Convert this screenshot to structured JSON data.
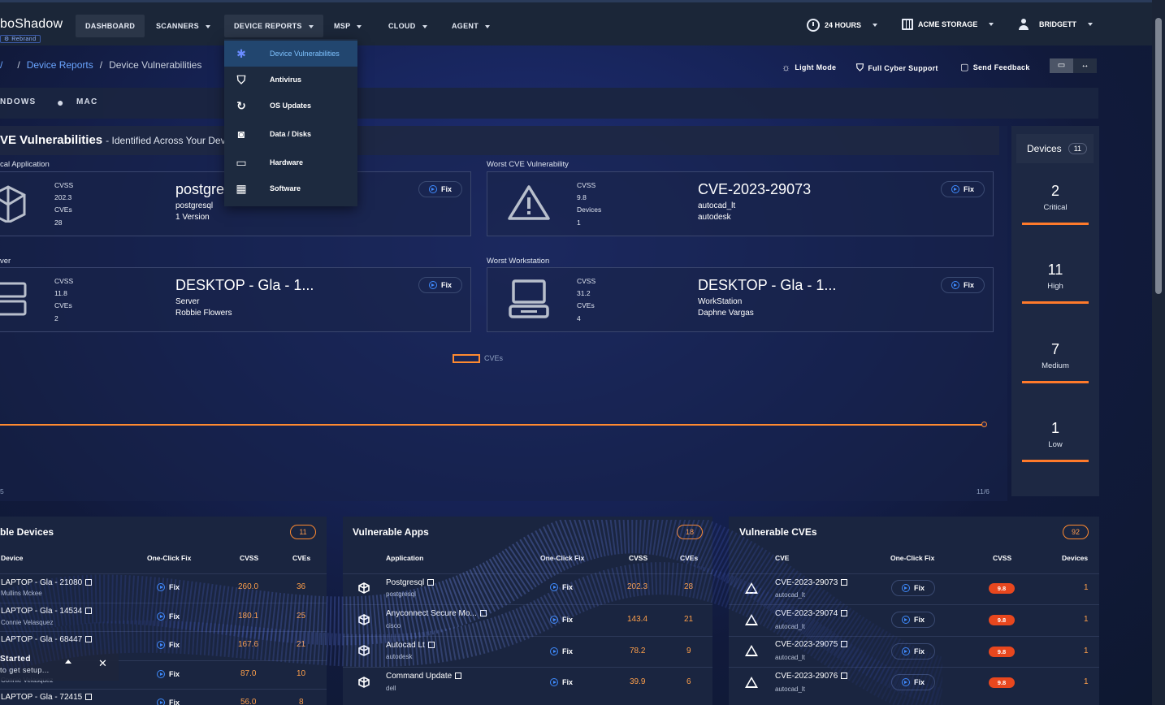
{
  "brand": {
    "logo": "boShadow",
    "badge": "Rebrand"
  },
  "nav": {
    "items": [
      "DASHBOARD",
      "SCANNERS",
      "DEVICE REPORTS",
      "MSP",
      "CLOUD",
      "AGENT"
    ],
    "time_range": "24 HOURS",
    "org": "ACME STORAGE",
    "user": "BRIDGETT"
  },
  "dropdown": {
    "items": [
      "Device Vulnerabilities",
      "Antivirus",
      "OS Updates",
      "Data / Disks",
      "Hardware",
      "Software"
    ]
  },
  "breadcrumb": {
    "root": "/",
    "parent": "Device Reports",
    "current": "Device Vulnerabilities"
  },
  "tools": {
    "light_mode": "Light Mode",
    "support": "Full Cyber Support",
    "feedback": "Send Feedback"
  },
  "os_tabs": [
    "NDOWS",
    "MAC"
  ],
  "cve_section": {
    "title": "VE Vulnerabilities",
    "subtitle": "- Identified Across Your Devic",
    "cards": [
      {
        "label": "cal Application",
        "metric1": "CVSS",
        "value1": "202.3",
        "metric2": "CVEs",
        "value2": "28",
        "name": "postgre",
        "line1": "postgresql",
        "line2": "1 Version",
        "fix": "Fix"
      },
      {
        "label": "Worst CVE Vulnerability",
        "metric1": "CVSS",
        "value1": "9.8",
        "metric2": "Devices",
        "value2": "1",
        "name": "CVE-2023-29073",
        "line1": "autocad_lt",
        "line2": "autodesk",
        "fix": "Fix"
      },
      {
        "label": "ver",
        "metric1": "CVSS",
        "value1": "11.8",
        "metric2": "CVEs",
        "value2": "2",
        "name": "DESKTOP - Gla - 1...",
        "line1": "Server",
        "line2": "Robbie Flowers",
        "fix": "Fix"
      },
      {
        "label": "Worst Workstation",
        "metric1": "CVSS",
        "value1": "31.2",
        "metric2": "CVEs",
        "value2": "4",
        "name": "DESKTOP - Gla - 1...",
        "line1": "WorkStation",
        "line2": "Daphne Vargas",
        "fix": "Fix"
      }
    ],
    "legend": "CVEs",
    "x_left": "5",
    "x_right": "11/6"
  },
  "devices": {
    "title": "Devices",
    "count": "11",
    "severities": [
      {
        "n": "2",
        "label": "Critical"
      },
      {
        "n": "11",
        "label": "High"
      },
      {
        "n": "7",
        "label": "Medium"
      },
      {
        "n": "1",
        "label": "Low"
      }
    ]
  },
  "tables": {
    "devices": {
      "title": "ble Devices",
      "count": "11",
      "headers": [
        "Device",
        "One-Click Fix",
        "CVSS",
        "CVEs"
      ],
      "rows": [
        {
          "name": "LAPTOP - Gla - 21080",
          "sub": "Mullins Mckee",
          "cvss": "260.0",
          "cves": "36"
        },
        {
          "name": "LAPTOP - Gla - 14534",
          "sub": "Connie Velasquez",
          "cvss": "180.1",
          "cves": "25"
        },
        {
          "name": "LAPTOP - Gla - 68447",
          "sub": "",
          "cvss": "167.6",
          "cves": "21"
        },
        {
          "name": "",
          "sub": "Connie Velasquez",
          "cvss": "87.0",
          "cves": "10"
        },
        {
          "name": "LAPTOP - Gla - 72415",
          "sub": "",
          "cvss": "56.0",
          "cves": "8"
        }
      ]
    },
    "apps": {
      "title": "Vulnerable Apps",
      "count": "18",
      "headers": [
        "Application",
        "One-Click Fix",
        "CVSS",
        "CVEs"
      ],
      "rows": [
        {
          "name": "Postgresql",
          "sub": "postgresql",
          "cvss": "202.3",
          "cves": "28"
        },
        {
          "name": "Anyconnect Secure Mo...",
          "sub": "cisco",
          "cvss": "143.4",
          "cves": "21"
        },
        {
          "name": "Autocad Lt",
          "sub": "autodesk",
          "cvss": "78.2",
          "cves": "9"
        },
        {
          "name": "Command Update",
          "sub": "dell",
          "cvss": "39.9",
          "cves": "6"
        }
      ]
    },
    "cves": {
      "title": "Vulnerable CVEs",
      "count": "92",
      "headers": [
        "CVE",
        "One-Click Fix",
        "CVSS",
        "Devices"
      ],
      "rows": [
        {
          "name": "CVE-2023-29073",
          "sub": "autocad_lt",
          "cvss": "9.8",
          "devices": "1"
        },
        {
          "name": "CVE-2023-29074",
          "sub": "autocad_lt",
          "cvss": "9.8",
          "devices": "1"
        },
        {
          "name": "CVE-2023-29075",
          "sub": "autocad_lt",
          "cvss": "9.8",
          "devices": "1"
        },
        {
          "name": "CVE-2023-29076",
          "sub": "autocad_lt",
          "cvss": "9.8",
          "devices": "1"
        }
      ]
    },
    "fix_label": "Fix"
  },
  "toast": {
    "title": "Started",
    "body": "to get setup..."
  },
  "colors": {
    "accent": "#ff8a30",
    "link": "#6aa5ff",
    "critical": "#e8471e",
    "bg": "#0f1a2e"
  }
}
